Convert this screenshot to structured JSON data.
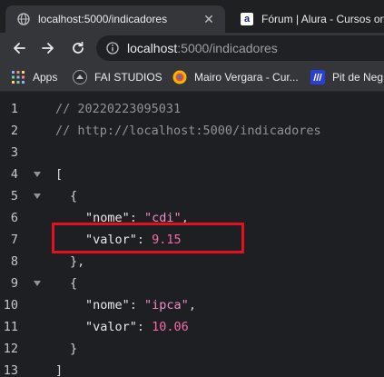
{
  "tabs": [
    {
      "title": "localhost:5000/indicadores",
      "active": true,
      "close": "✕"
    },
    {
      "title": "Fórum | Alura - Cursos online",
      "active": false
    }
  ],
  "omnibox": {
    "host": "localhost",
    "rest": ":5000/indicadores"
  },
  "bookmarks": [
    {
      "label": "Apps",
      "icon": "apps-grid-icon"
    },
    {
      "label": "FAI STUDIOS",
      "icon": "fai-studios-icon"
    },
    {
      "label": "Mairo Vergara - Cur...",
      "icon": "mairo-vergara-icon"
    },
    {
      "label": "Pit de Neg",
      "icon": "pit-de-negocios-icon"
    }
  ],
  "code_lines": [
    {
      "num": "1",
      "comment": "// 20220223095031"
    },
    {
      "num": "2",
      "comment": "// http://localhost:5000/indicadores"
    },
    {
      "num": "3"
    },
    {
      "num": "4",
      "open": "["
    },
    {
      "num": "5",
      "open": "{"
    },
    {
      "num": "6",
      "key": "\"nome\"",
      "sep": ": ",
      "str": "\"cdi\"",
      "end": ","
    },
    {
      "num": "7",
      "key": "\"valor\"",
      "sep": ": ",
      "number": "9.15"
    },
    {
      "num": "8",
      "close": "},"
    },
    {
      "num": "9",
      "open": "{"
    },
    {
      "num": "10",
      "key": "\"nome\"",
      "sep": ": ",
      "str": "\"ipca\"",
      "end": ","
    },
    {
      "num": "11",
      "key": "\"valor\"",
      "sep": ": ",
      "number": "10.06"
    },
    {
      "num": "12",
      "close": "}"
    },
    {
      "num": "13",
      "close": "]"
    }
  ],
  "colors": {
    "highlight_box": "#e3101f",
    "string": "#f08ec8",
    "number": "#f26ba8",
    "comment": "#8e9399"
  }
}
